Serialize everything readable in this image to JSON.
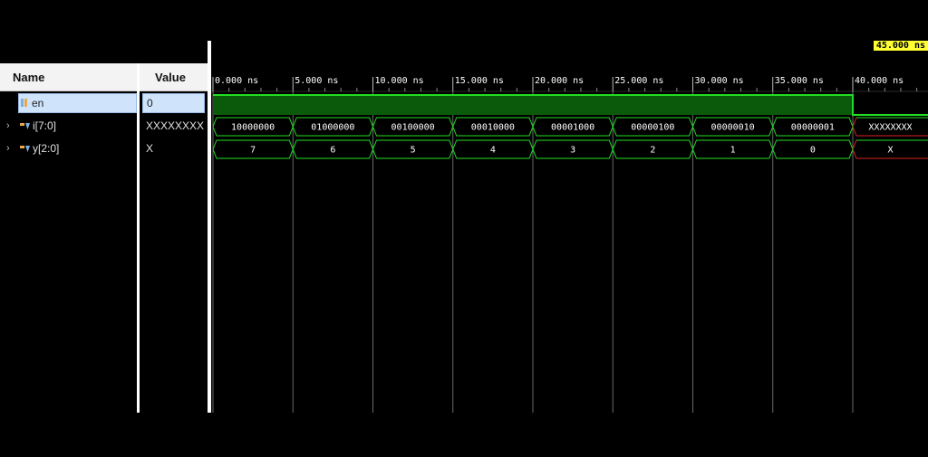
{
  "headers": {
    "name": "Name",
    "value": "Value"
  },
  "signals": [
    {
      "name": "en",
      "value": "0",
      "icon": "scalar-signal-icon",
      "expandable": false
    },
    {
      "name": "i[7:0]",
      "value": "XXXXXXXX",
      "icon": "bus-signal-icon",
      "expandable": true
    },
    {
      "name": "y[2:0]",
      "value": "X",
      "icon": "bus-signal-icon",
      "expandable": true
    }
  ],
  "timeline": {
    "unit": "ns",
    "ticks": [
      {
        "t": 0,
        "label": "0.000 ns"
      },
      {
        "t": 5,
        "label": "5.000 ns"
      },
      {
        "t": 10,
        "label": "10.000 ns"
      },
      {
        "t": 15,
        "label": "15.000 ns"
      },
      {
        "t": 20,
        "label": "20.000 ns"
      },
      {
        "t": 25,
        "label": "25.000 ns"
      },
      {
        "t": 30,
        "label": "30.000 ns"
      },
      {
        "t": 35,
        "label": "35.000 ns"
      },
      {
        "t": 40,
        "label": "40.000 ns"
      }
    ],
    "view_start": 0,
    "view_end": 44.8,
    "cursor": {
      "t": 45,
      "label": "45.000 ns"
    }
  },
  "waves": {
    "en": {
      "high_until": 40,
      "low_after": 40
    },
    "i": [
      {
        "start": 0,
        "end": 5,
        "value": "10000000"
      },
      {
        "start": 5,
        "end": 10,
        "value": "01000000"
      },
      {
        "start": 10,
        "end": 15,
        "value": "00100000"
      },
      {
        "start": 15,
        "end": 20,
        "value": "00010000"
      },
      {
        "start": 20,
        "end": 25,
        "value": "00001000"
      },
      {
        "start": 25,
        "end": 30,
        "value": "00000100"
      },
      {
        "start": 30,
        "end": 35,
        "value": "00000010"
      },
      {
        "start": 35,
        "end": 40,
        "value": "00000001"
      },
      {
        "start": 40,
        "end": 45,
        "value": "XXXXXXXX"
      }
    ],
    "y": [
      {
        "start": 0,
        "end": 5,
        "value": "7"
      },
      {
        "start": 5,
        "end": 10,
        "value": "6"
      },
      {
        "start": 10,
        "end": 15,
        "value": "5"
      },
      {
        "start": 15,
        "end": 20,
        "value": "4"
      },
      {
        "start": 20,
        "end": 25,
        "value": "3"
      },
      {
        "start": 25,
        "end": 30,
        "value": "2"
      },
      {
        "start": 30,
        "end": 35,
        "value": "1"
      },
      {
        "start": 35,
        "end": 40,
        "value": "0"
      },
      {
        "start": 40,
        "end": 45,
        "value": "X"
      }
    ]
  },
  "colors": {
    "wave_green": "#22dd22",
    "en_fill": "#0b5a0b",
    "unknown_red": "#dd2222",
    "grid": "#6a6a6a",
    "cursor_fill": "#ffff33",
    "selection": "#cfe3fb"
  }
}
